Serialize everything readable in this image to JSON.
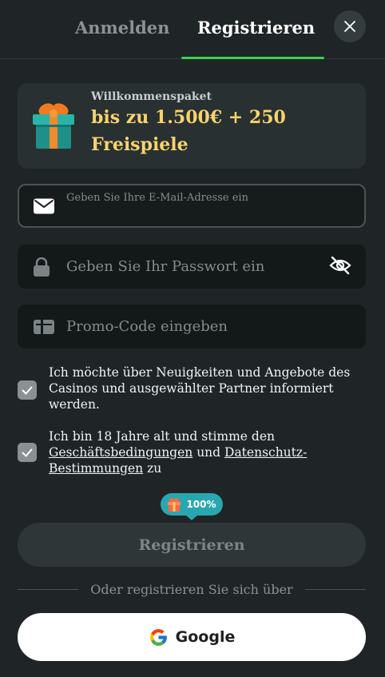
{
  "tabs": {
    "login_label": "Anmelden",
    "register_label": "Registrieren"
  },
  "close_icon": "close-icon",
  "bonus": {
    "label": "Willkommenspaket",
    "value": "bis zu 1.500€ + 250 Freispiele",
    "icon": "gift-icon"
  },
  "form": {
    "email": {
      "placeholder": "Geben Sie Ihre E-Mail-Adresse ein",
      "value": "",
      "icon": "mail-icon"
    },
    "password": {
      "placeholder": "Geben Sie Ihr Passwort ein",
      "value": "",
      "icon": "lock-icon",
      "toggle_icon": "eye-off-icon"
    },
    "promo": {
      "placeholder": "Promo-Code eingeben",
      "value": "",
      "icon": "voucher-icon"
    }
  },
  "consents": {
    "newsletter": {
      "checked": true,
      "text": "Ich möchte über Neuigkeiten und Angebote des Casinos und ausgewählter Partner informiert werden."
    },
    "terms": {
      "checked": true,
      "text_before": "Ich bin 18 Jahre alt und stimme den ",
      "terms_link": "Geschäftsbedingungen",
      "text_middle": " und ",
      "privacy_link": "Datenschutz-Bestimmungen",
      "text_after": " zu"
    }
  },
  "progress_badge": {
    "value": "100%",
    "icon": "gift-icon"
  },
  "register_button": "Registrieren",
  "divider_text": "Oder registrieren Sie sich über",
  "google_button": {
    "label": "Google",
    "icon": "google-icon"
  },
  "colors": {
    "background": "#1f2526",
    "accent_green": "#3ecf55",
    "bonus_yellow": "#f7d36e",
    "badge_teal": "#2aa6b0"
  }
}
